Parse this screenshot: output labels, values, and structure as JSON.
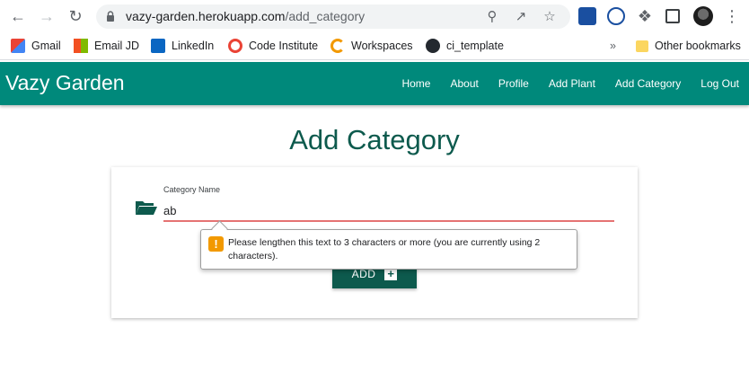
{
  "browser": {
    "url_host": "vazy-garden.herokuapp.com",
    "url_path": "/add_category",
    "icons": [
      "back-icon",
      "forward-icon",
      "reload-icon",
      "lock-icon",
      "zoom-icon",
      "share-icon",
      "star-icon",
      "extension-icon",
      "puzzle-icon",
      "sidepanel-icon",
      "avatar",
      "kebab-menu-icon"
    ]
  },
  "bookmarks": {
    "items": [
      {
        "label": "Gmail",
        "icon": "gmail-icon"
      },
      {
        "label": "Email JD",
        "icon": "microsoft-icon"
      },
      {
        "label": "LinkedIn",
        "icon": "linkedin-icon"
      },
      {
        "label": "Code Institute",
        "icon": "code-institute-icon"
      },
      {
        "label": "Workspaces",
        "icon": "workspaces-icon"
      },
      {
        "label": "ci_template",
        "icon": "github-icon"
      }
    ],
    "overflow": "»",
    "other": "Other bookmarks"
  },
  "navbar": {
    "brand": "Vazy Garden",
    "links": [
      "Home",
      "About",
      "Profile",
      "Add Plant",
      "Add Category",
      "Log Out"
    ],
    "color": "#00897b"
  },
  "page": {
    "title": "Add Category",
    "form": {
      "label": "Category Name",
      "value": "ab",
      "button": "ADD",
      "button_color": "#0d5a4d"
    },
    "validation_message": "Please lengthen this text to 3 characters or more (you are currently using 2 characters)."
  }
}
